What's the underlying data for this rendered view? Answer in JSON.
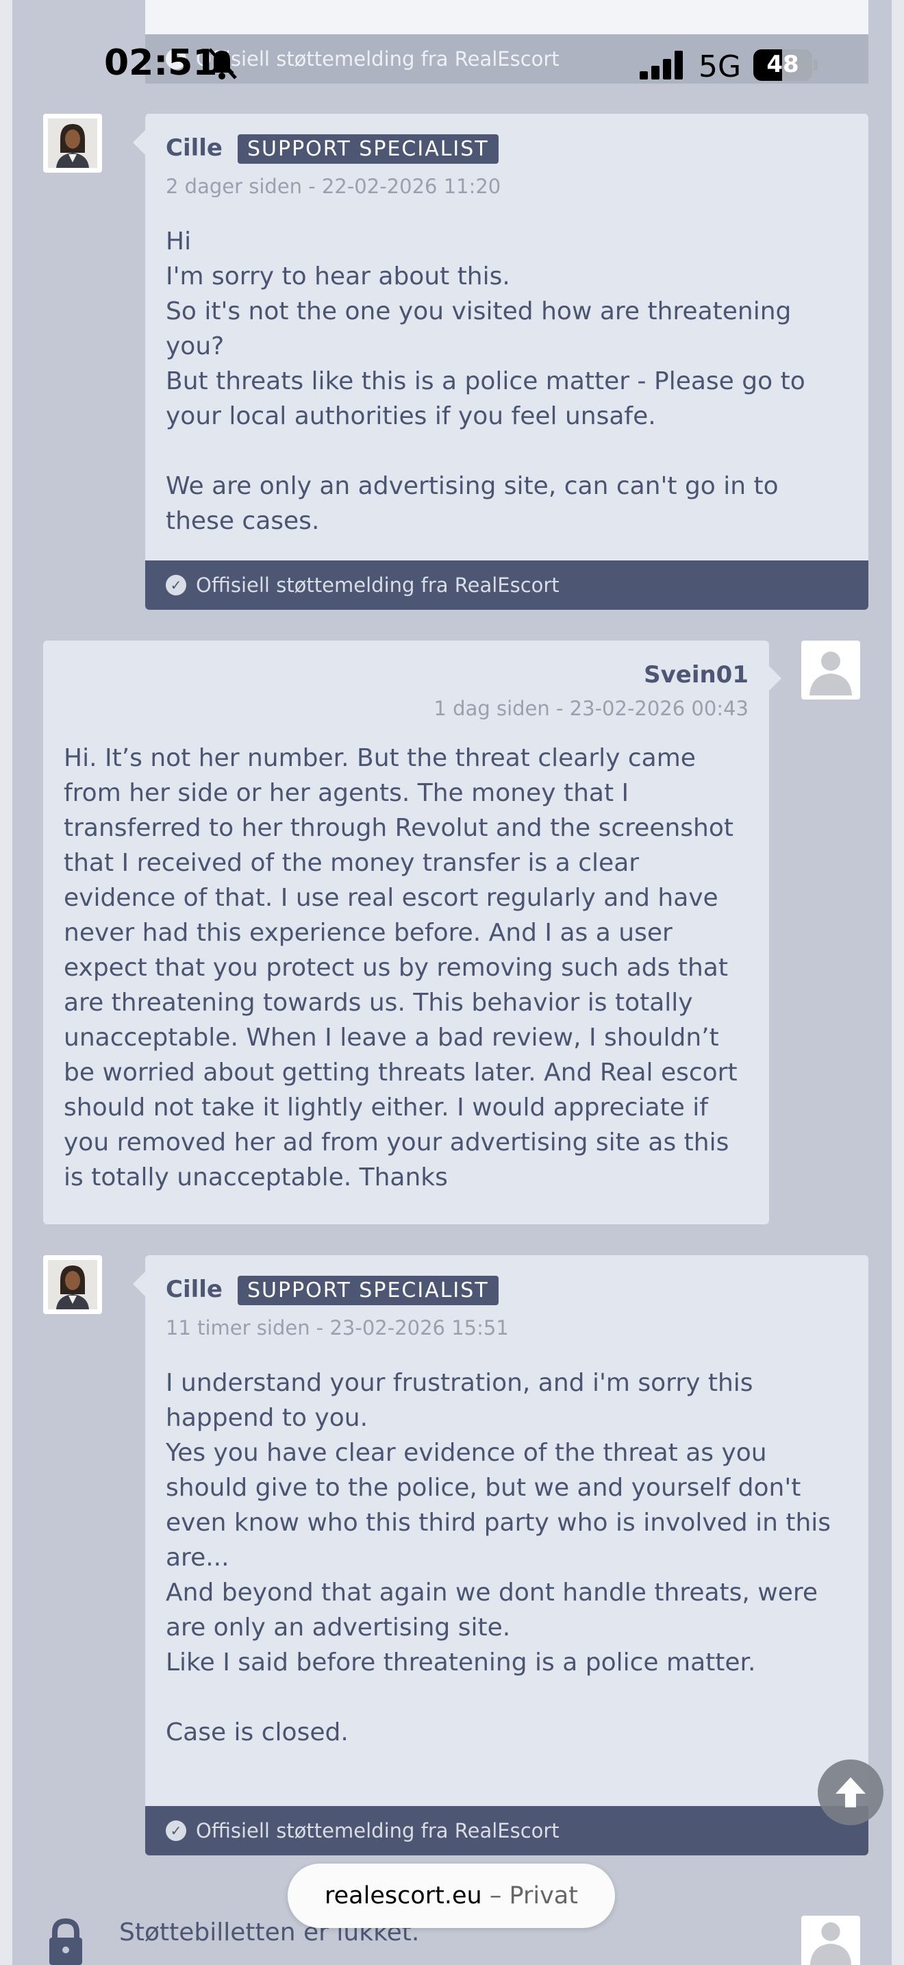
{
  "status_bar": {
    "time": "02:51",
    "network": "5G",
    "battery": "48",
    "icons": [
      "bell-muted-icon",
      "signal-icon",
      "battery-icon"
    ]
  },
  "top_footer_text": "Offisiell støttemelding fra RealEscort",
  "messages": [
    {
      "author": "Cille",
      "badge": "SUPPORT SPECIALIST",
      "time": "2 dager siden - 22-02-2026 11:20",
      "body": "Hi\nI'm sorry to hear about this.\nSo it's not the one you visited how are threatening you?\nBut threats like this is a police matter - Please go to your local authorities if you feel unsafe.\n\nWe are only an advertising site, can can't go in to these cases.",
      "footer": "Offisiell støttemelding fra RealEscort"
    },
    {
      "author": "Svein01",
      "time": "1 dag siden - 23-02-2026 00:43",
      "body": "Hi. It’s not her number. But the threat clearly came from her side or her agents. The money that I transferred to her through Revolut and the screenshot that I received of the money transfer is a clear evidence of that. I use real escort regularly and have never had this experience before. And I as a user expect that you protect us by removing such ads that are threatening towards us. This behavior is totally unacceptable. When I leave a bad review, I shouldn’t be worried about getting threats later. And Real escort should not take it lightly either. I would appreciate if you removed her ad from your advertising site as this is totally unacceptable. Thanks"
    },
    {
      "author": "Cille",
      "badge": "SUPPORT SPECIALIST",
      "time": "11 timer siden - 23-02-2026 15:51",
      "body": "I understand your frustration, and i'm sorry this happend to you.\nYes you have clear evidence of the threat as you should give to the police, but we and yourself don't even know who this third party who is involved in this are...\nAnd beyond that again we dont handle threats, were are only an advertising site.\nLike I said before threatening is a police matter.\n\nCase is closed.",
      "footer": "Offisiell støttemelding fra RealEscort"
    }
  ],
  "closed_notice": "Støttebilletten er lukket.",
  "url_bar": {
    "domain": "realescort.eu",
    "suffix": " – Privat"
  },
  "scroll_top_icon": "arrow-up-icon",
  "colors": {
    "page_bg": "#c3c8d4",
    "card_bg": "#e1e6ef",
    "accent": "#4d5672"
  }
}
